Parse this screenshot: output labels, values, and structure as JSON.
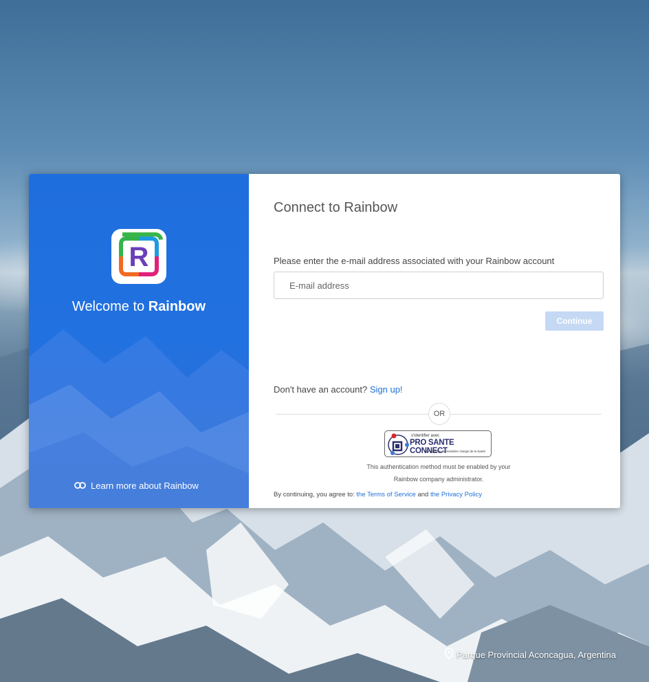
{
  "left_panel": {
    "welcome_prefix": "Welcome to",
    "welcome_brand": "Rainbow",
    "learn_more": "Learn more about Rainbow"
  },
  "form": {
    "title": "Connect to Rainbow",
    "prompt": "Please enter the e-mail address associated with your Rainbow account",
    "email_placeholder": "E-mail address",
    "email_value": "",
    "continue_label": "Continue",
    "no_account_text": "Don't have an account?",
    "signup_link": "Sign up!",
    "or_label": "OR",
    "psc_small": "s'identifier avec",
    "psc_big": "PRO SANTE CONNECT",
    "psc_tiny": "Un service du ministère chargé de la Santé",
    "auth_note_line1": "This authentication method must be enabled by your",
    "auth_note_line2": "Rainbow company administrator.",
    "terms_prefix": "By continuing, you agree to:",
    "terms_link": "the Terms of Service",
    "terms_and": "and",
    "privacy_link": "the Privacy Policy"
  },
  "location": "Parque Provincial Aconcagua, Argentina",
  "icons": {
    "logo": "rainbow-logo-icon",
    "link": "link-icon",
    "location": "location-pin-icon"
  },
  "colors": {
    "brand_blue": "#2271e0",
    "continue_disabled": "#c5d9f4",
    "link_blue": "#1e6fd9"
  }
}
